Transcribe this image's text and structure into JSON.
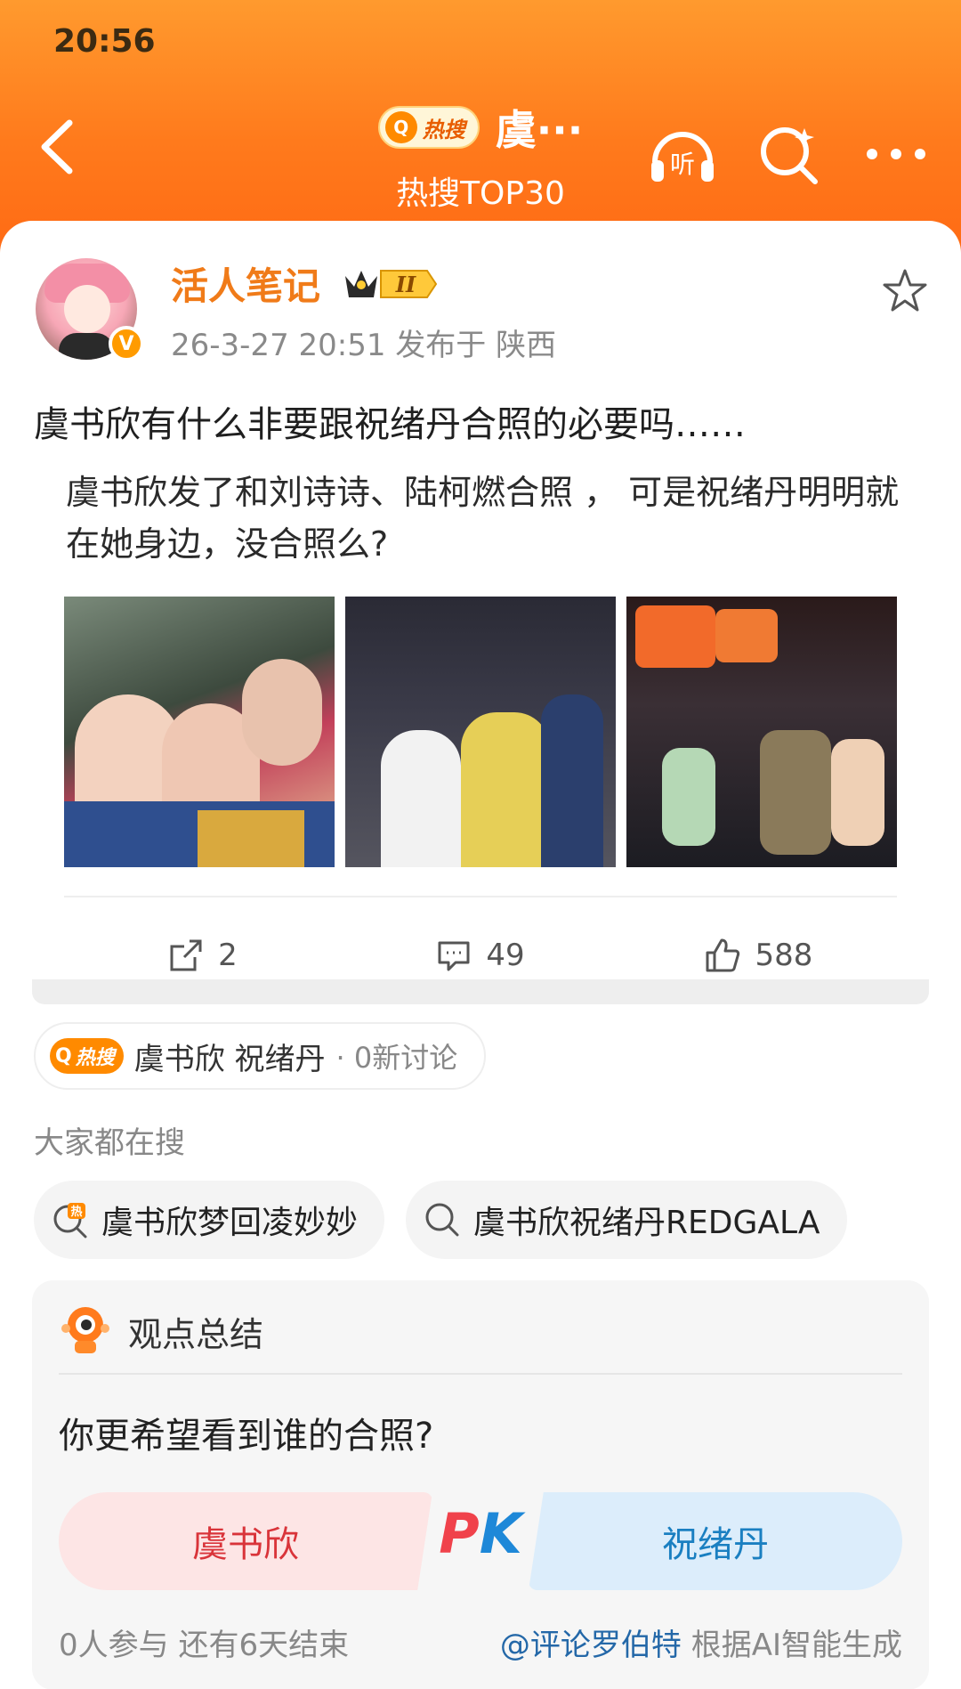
{
  "status_bar": {
    "time": "20:56"
  },
  "nav": {
    "hot_pill": "热搜",
    "title": "虞···",
    "subtitle": "热搜TOP30",
    "listen_label": "听"
  },
  "post": {
    "author": "活人笔记",
    "vip_level": "II",
    "verified": "V",
    "meta": "26-3-27 20:51  发布于 陕西",
    "title": "虞书欣有什么非要跟祝绪丹合照的必要吗……",
    "body": "虞书欣发了和刘诗诗、陆柯燃合照 ， 可是祝绪丹明明就在她身边，没合照么?",
    "image_count": 3,
    "actions": {
      "repost": "2",
      "comment": "49",
      "like": "588"
    }
  },
  "hot_topic": {
    "badge": "热搜",
    "topic": "虞书欣 祝绪丹",
    "count": "· 0新讨论"
  },
  "everyone_search": {
    "label": "大家都在搜",
    "chips": [
      {
        "text": "虞书欣梦回凌妙妙",
        "icon": "hot-search-icon"
      },
      {
        "text": "虞书欣祝绪丹REDGALA",
        "icon": "search-icon"
      }
    ]
  },
  "summary": {
    "title": "观点总结",
    "question": "你更希望看到谁的合照?",
    "left_option": "虞书欣",
    "pk_p": "P",
    "pk_k": "K",
    "right_option": "祝绪丹",
    "participants": "0人参与  还有6天结束",
    "source_link": "@评论罗伯特",
    "source_suffix": " 根据AI智能生成"
  },
  "colors": {
    "header_orange": "#ff7a1c",
    "author_orange": "#f07b19",
    "pk_red": "#f0424b",
    "pk_blue": "#1e88d8"
  }
}
